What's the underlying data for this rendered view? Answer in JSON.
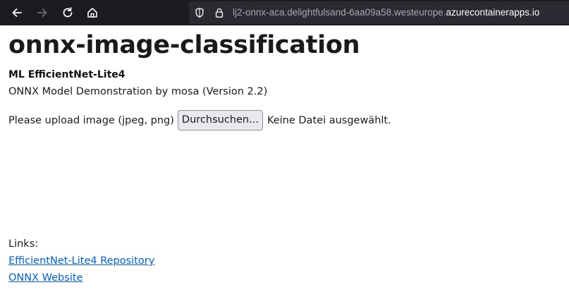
{
  "browser": {
    "url_host": "lj2-onnx-aca.delightfulsand-6aa09a58.westeurope.",
    "url_domain": "azurecontainerapps.io",
    "icons": {
      "back": "back-arrow-icon",
      "forward": "forward-arrow-icon",
      "reload": "reload-icon",
      "home": "home-icon",
      "tracking": "shield-icon",
      "security": "lock-icon"
    }
  },
  "page": {
    "title": "onnx-image-classification",
    "model_name": "ML EfficientNet-Lite4",
    "subtitle": "ONNX Model Demonstration by mosa (Version 2.2)",
    "upload": {
      "label": "Please upload image (jpeg, png)",
      "button_label": "Durchsuchen...",
      "status": "Keine Datei ausgewählt."
    },
    "links": {
      "label": "Links:",
      "items": [
        {
          "text": "EfficientNet-Lite4 Repository"
        },
        {
          "text": "ONNX Website"
        }
      ]
    }
  },
  "colors": {
    "toolbar_bg": "#1c1b22",
    "urlbar_bg": "#2b2a33",
    "link": "#0060df"
  }
}
